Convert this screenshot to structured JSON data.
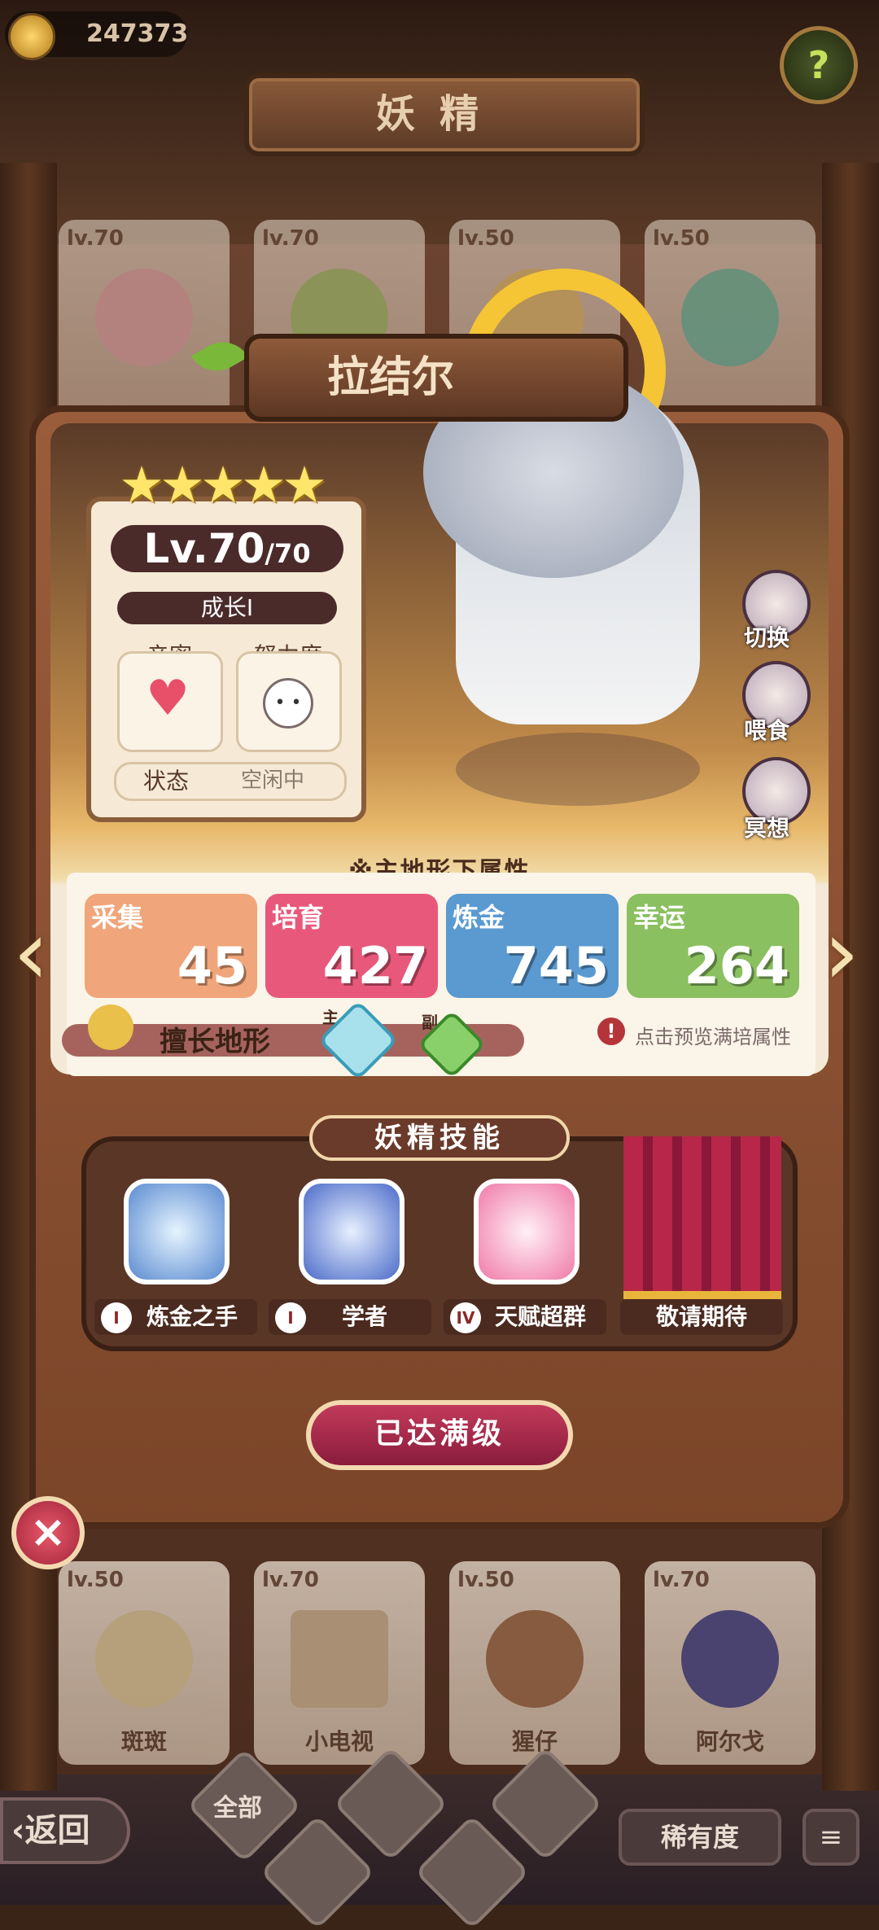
{
  "header": {
    "currency_value": "247373",
    "title": "妖精",
    "help_icon": "question-sprout-icon"
  },
  "roster_top": [
    {
      "level": "lv.70",
      "name": ""
    },
    {
      "level": "lv.70",
      "name": ""
    },
    {
      "level": "lv.50",
      "name": ""
    },
    {
      "level": "lv.50",
      "name": ""
    }
  ],
  "roster_bottom": [
    {
      "level": "lv.50",
      "name": "斑斑"
    },
    {
      "level": "lv.70",
      "name": "小电视"
    },
    {
      "level": "lv.50",
      "name": "猩仔"
    },
    {
      "level": "lv.70",
      "name": "阿尔戈"
    }
  ],
  "fairy": {
    "name": "拉结尔",
    "stars": 5,
    "level_current": "Lv.70",
    "level_max": "/70",
    "growth": "成长I",
    "intimacy_label": "亲密",
    "effort_label": "努力度",
    "status_label": "状态",
    "status_value": "空闲中"
  },
  "side_actions": [
    {
      "label": "切换",
      "icon": "switch-icon"
    },
    {
      "label": "喂食",
      "icon": "meat-icon"
    },
    {
      "label": "冥想",
      "icon": "meditate-icon"
    }
  ],
  "attributes": {
    "title": "※主地形下属性",
    "items": [
      {
        "name": "采集",
        "value": "45",
        "color": "#f0a57a"
      },
      {
        "name": "培育",
        "value": "427",
        "color": "#e8587a"
      },
      {
        "name": "炼金",
        "value": "745",
        "color": "#5a9ad0"
      },
      {
        "name": "幸运",
        "value": "264",
        "color": "#8ac060"
      }
    ],
    "terrain_label": "擅长地形",
    "terrain_main_tag": "主",
    "terrain_sub_tag": "副",
    "preview_hint": "点击预览满培属性"
  },
  "skills": {
    "title": "妖精技能",
    "items": [
      {
        "rank": "I",
        "label": "炼金之手"
      },
      {
        "rank": "I",
        "label": "学者"
      },
      {
        "rank": "IV",
        "label": "天赋超群"
      },
      {
        "rank": "",
        "label": "敬请期待"
      }
    ]
  },
  "max_level_button": "已达满级",
  "bottom_bar": {
    "back": "返回",
    "filter_all": "全部",
    "rarity": "稀有度"
  },
  "colors": {
    "accent": "#b8264a",
    "panel": "#9a5d3b",
    "star": "#ffe66b"
  }
}
